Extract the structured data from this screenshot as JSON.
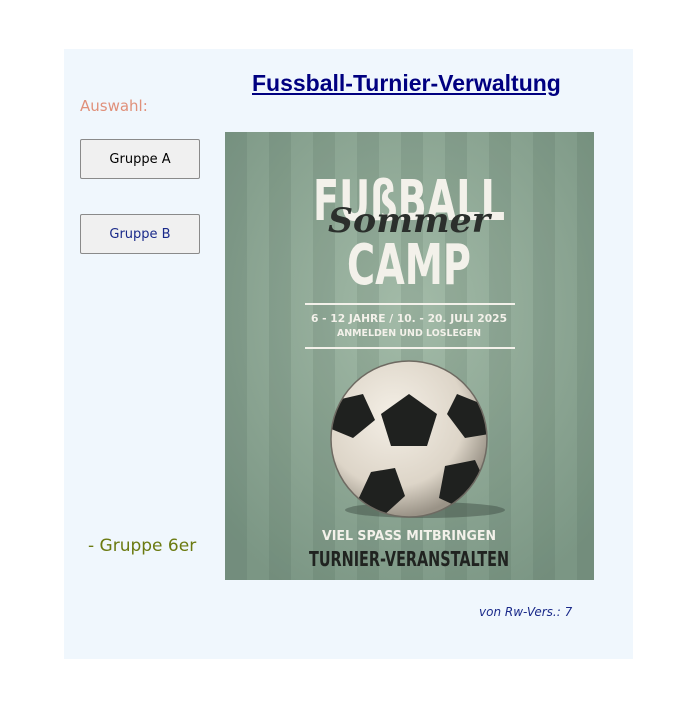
{
  "header": {
    "title": "Fussball-Turnier-Verwaltung"
  },
  "sidebar": {
    "label": "Auswahl:",
    "buttons": [
      {
        "label": "Gruppe A"
      },
      {
        "label": "Gruppe B"
      }
    ],
    "group_text": "- Gruppe 6er"
  },
  "poster": {
    "title_line1": "FUßBALL",
    "script_word": "Sommer",
    "title_line2": "CAMP",
    "info_line1": "6 - 12 JAHRE / 10. - 20. JULI 2025",
    "info_line2": "ANMELDEN UND LOSLEGEN",
    "bottom_line1": "VIEL SPASS MITBRINGEN",
    "bottom_line2": "TURNIER-VERANSTALTEN"
  },
  "footer": {
    "version": "von Rw-Vers.: 7"
  },
  "colors": {
    "title": "#000080",
    "label": "#e0907a",
    "group": "#6b7a10",
    "panel_bg": "#f0f7fd",
    "poster_bg": "#8aa592"
  }
}
